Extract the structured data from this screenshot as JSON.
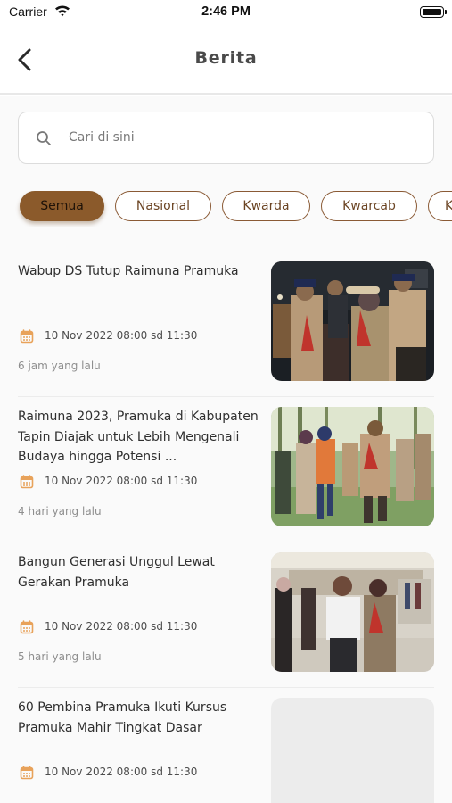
{
  "status_bar": {
    "carrier": "Carrier",
    "time": "2:46 PM"
  },
  "header": {
    "title": "Berita"
  },
  "search": {
    "placeholder": "Cari di sini"
  },
  "filters": [
    {
      "label": "Semua",
      "active": true
    },
    {
      "label": "Nasional",
      "active": false
    },
    {
      "label": "Kwarda",
      "active": false
    },
    {
      "label": "Kwarcab",
      "active": false
    },
    {
      "label": "Kwaran",
      "active": false
    }
  ],
  "news": [
    {
      "title": "Wabup DS Tutup Raimuna Pramuka",
      "date": "10 Nov 2022 08:00 sd 11:30",
      "ago": "6 jam yang lalu",
      "image": "scouts-night-ceremony"
    },
    {
      "title": "Raimuna 2023, Pramuka di Kabupaten Tapin Diajak untuk Lebih Mengenali Budaya hingga Potensi ...",
      "date": "10 Nov 2022 08:00 sd 11:30",
      "ago": "4 hari yang lalu",
      "image": "scouts-outdoor-field"
    },
    {
      "title": "Bangun Generasi Unggul Lewat Gerakan Pramuka",
      "date": "10 Nov 2022 08:00 sd 11:30",
      "ago": "5 hari yang lalu",
      "image": "scouts-indoor-hall"
    },
    {
      "title": "60 Pembina Pramuka Ikuti Kursus Pramuka Mahir Tingkat Dasar",
      "date": "10 Nov 2022 08:00 sd 11:30",
      "ago": "",
      "image": "placeholder"
    }
  ],
  "colors": {
    "accent": "#8b5a2b",
    "calendar_icon": "#e8a25a",
    "text": "#2f2f2f",
    "muted": "#8e8e8e"
  }
}
